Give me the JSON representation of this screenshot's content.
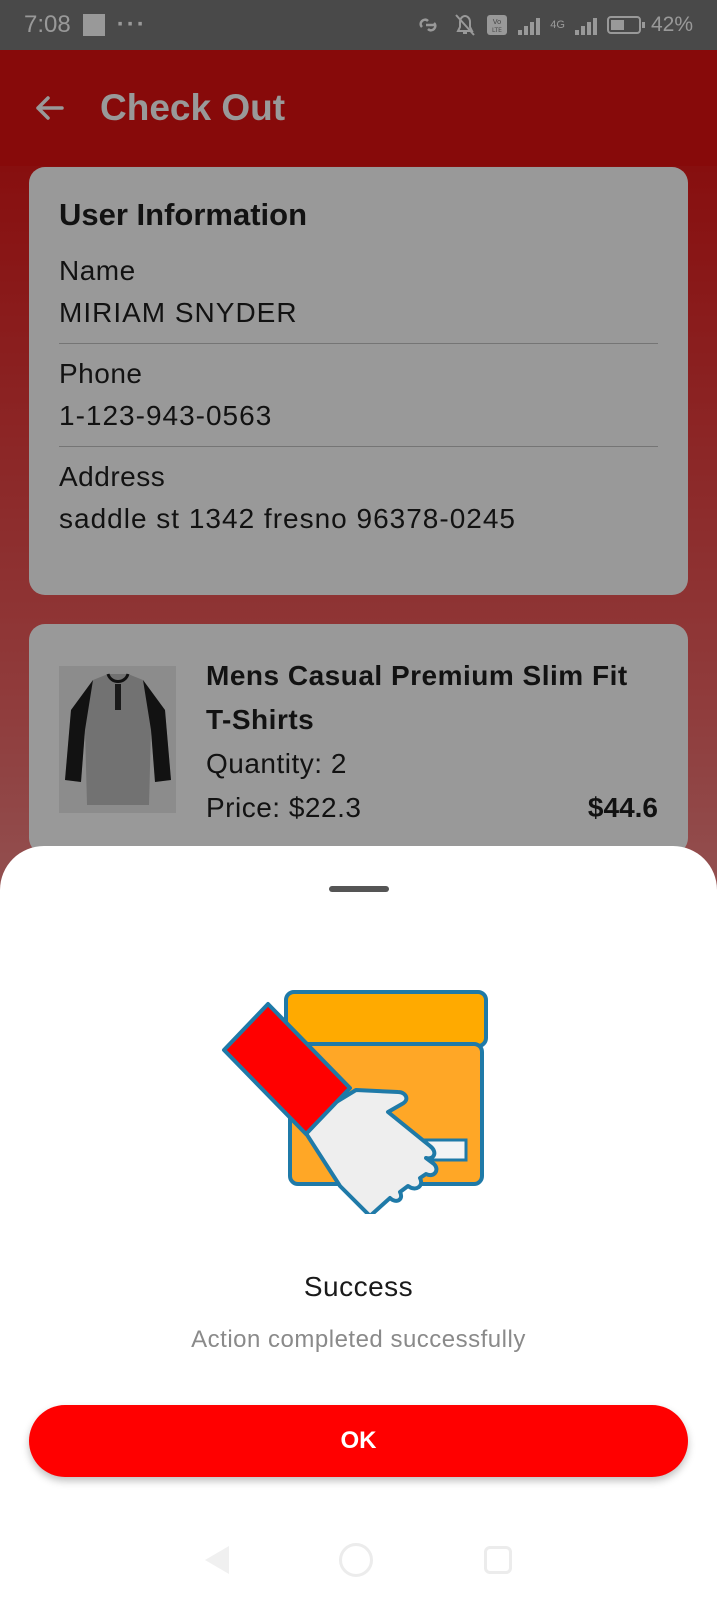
{
  "status_bar": {
    "time": "7:08",
    "more": "···",
    "battery_text": "42%",
    "network_label": "4G",
    "icons": [
      "link-icon",
      "bell-off-icon",
      "volte-icon",
      "signal-icon",
      "signal-4g-icon",
      "battery-charging-icon"
    ]
  },
  "app_bar": {
    "title": "Check Out",
    "back_icon": "arrow-left-icon",
    "color": "#e11111"
  },
  "user_info": {
    "title": "User Information",
    "fields": [
      {
        "label": "Name",
        "value": "MIRIAM SNYDER"
      },
      {
        "label": "Phone",
        "value": "1-123-943-0563"
      },
      {
        "label": "Address",
        "value": "saddle st 1342 fresno 96378-0245"
      }
    ]
  },
  "cart_item": {
    "name": "Mens Casual Premium Slim Fit T-Shirts",
    "quantity_text": "Quantity: 2",
    "price_text": "Price: $22.3",
    "total": "$44.6",
    "image_icon": "tshirt-image"
  },
  "dialog": {
    "title": "Success",
    "message": "Action completed successfully",
    "ok_label": "OK",
    "illustration": "delivery-handshake-illustration",
    "button_color": "#ff0000"
  },
  "nav": {
    "icons": [
      "nav-back-icon",
      "nav-home-icon",
      "nav-recents-icon"
    ]
  }
}
